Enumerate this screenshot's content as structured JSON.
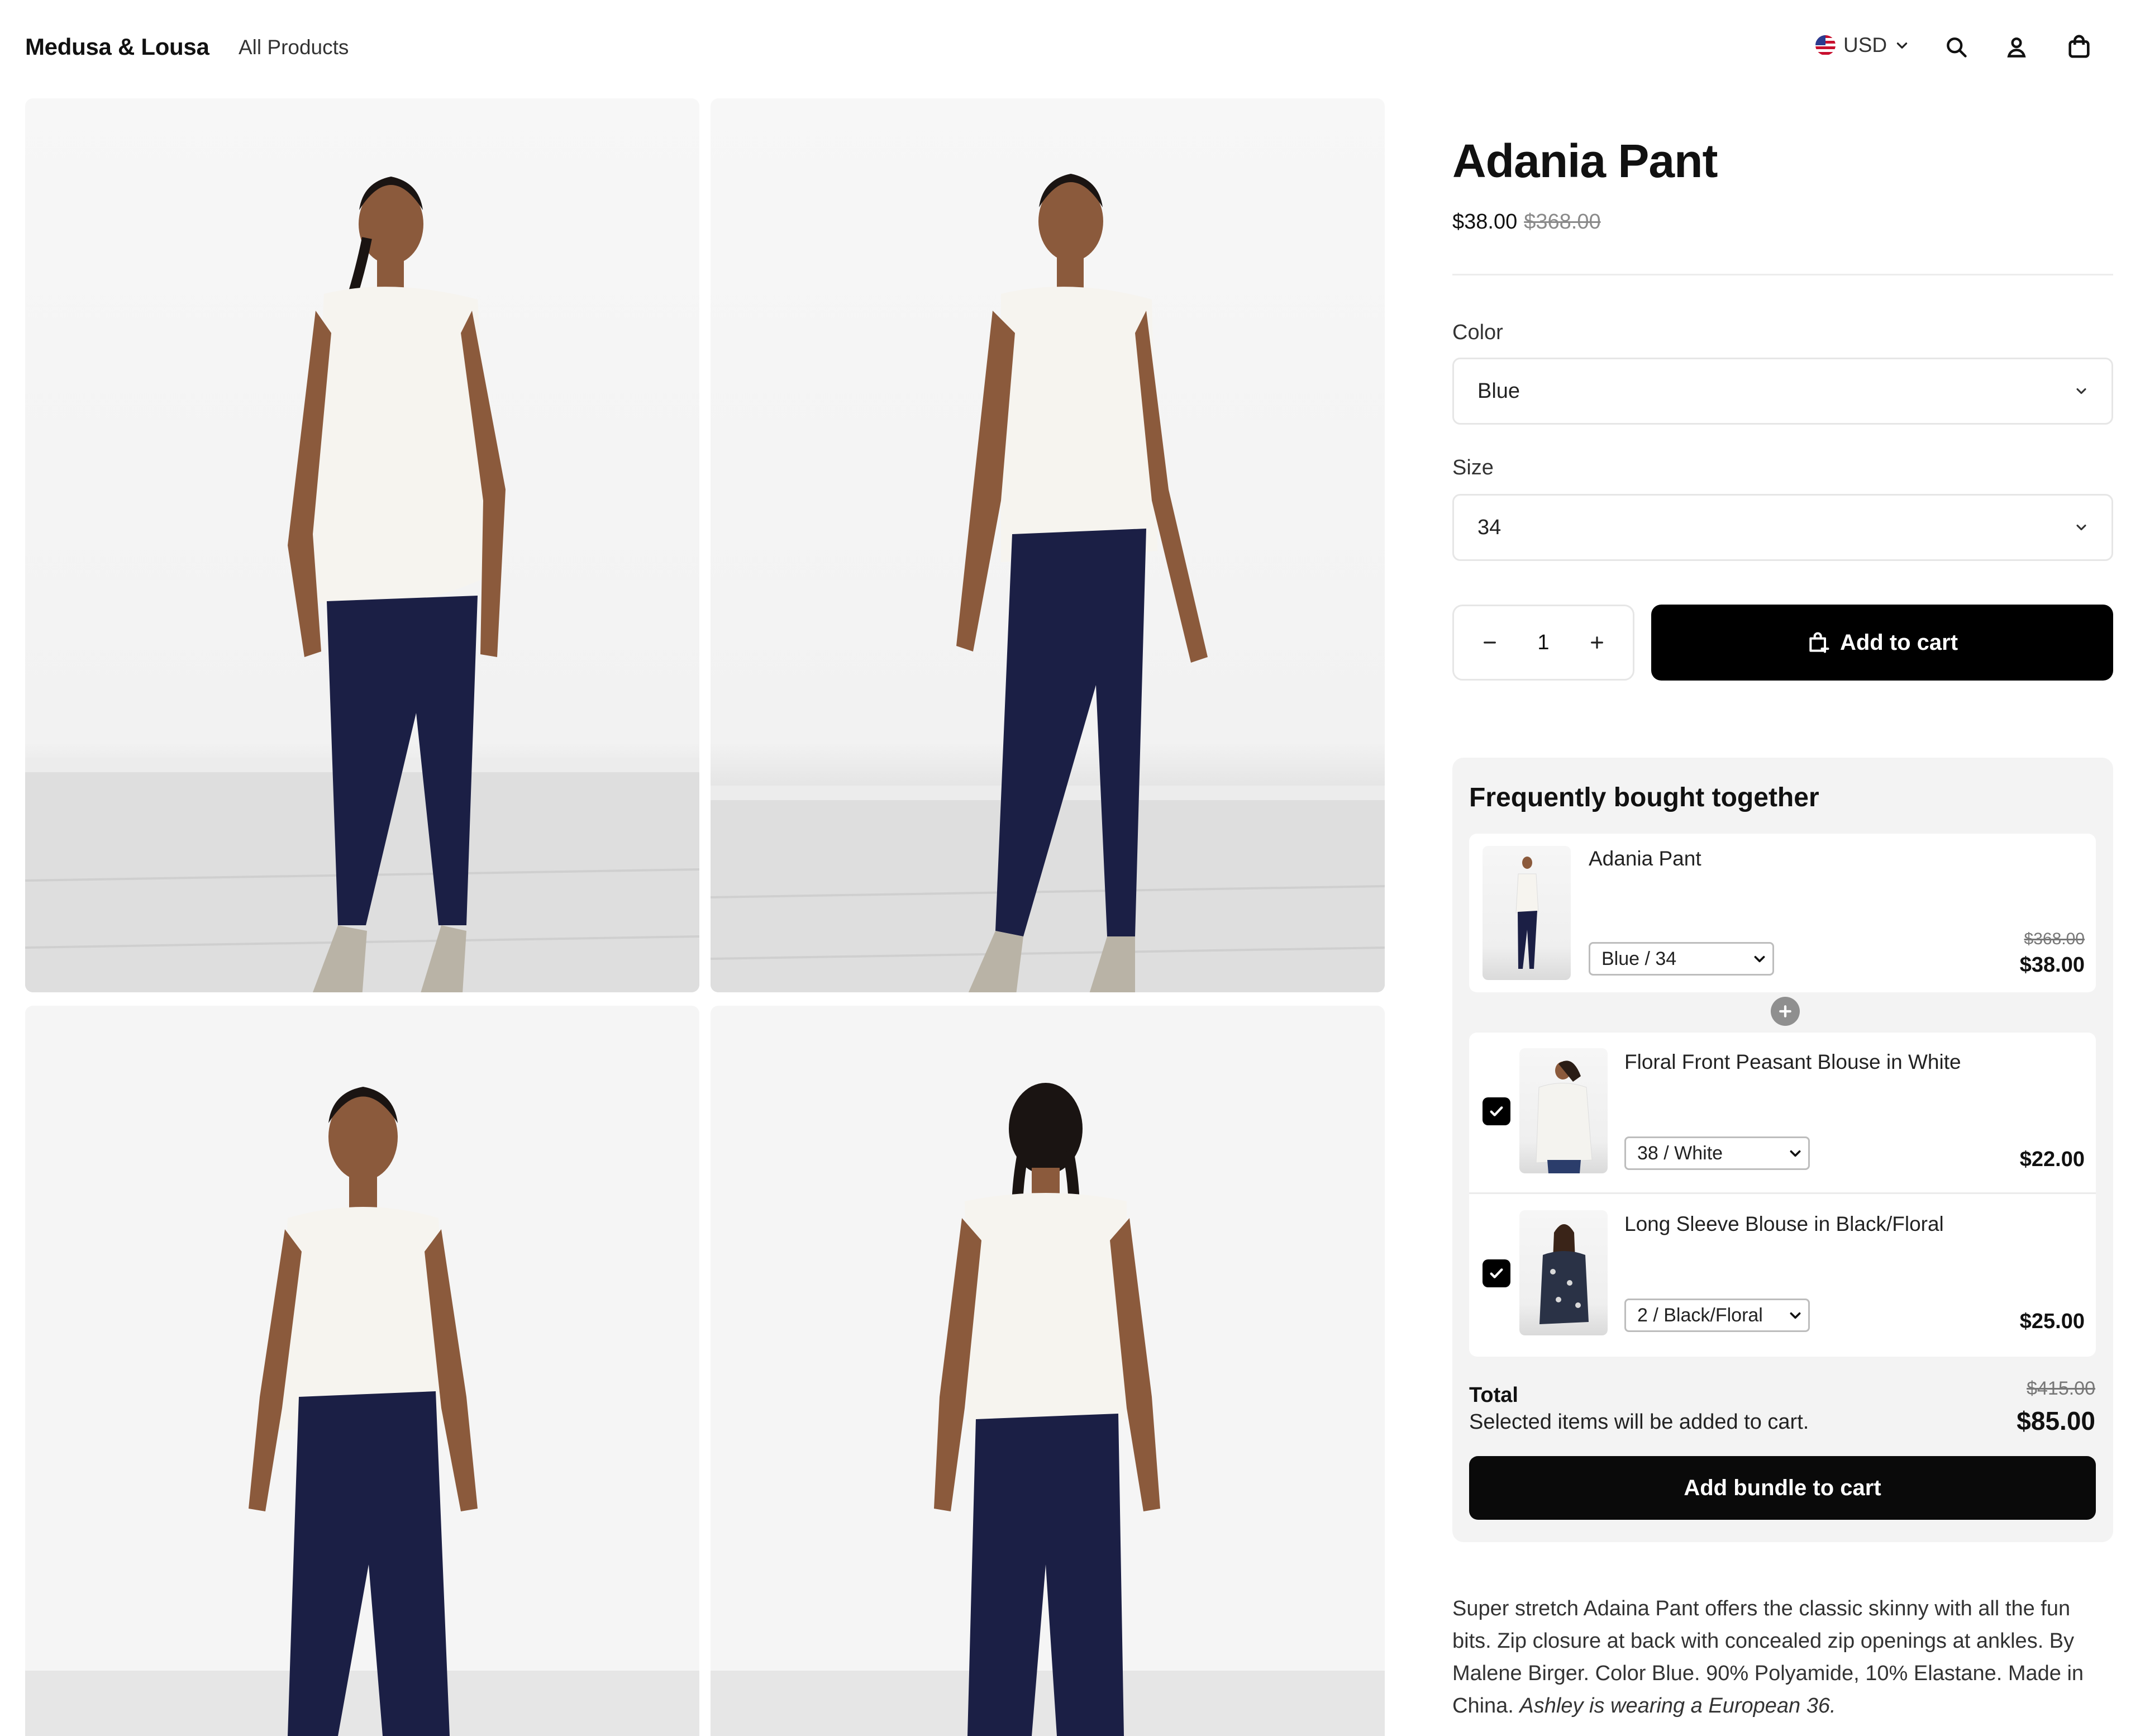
{
  "header": {
    "brand": "Medusa & Lousa",
    "nav_all_products": "All Products",
    "currency": "USD",
    "icons": [
      "search-icon",
      "user-icon",
      "shopping-bag-icon"
    ]
  },
  "product": {
    "title": "Adania Pant",
    "price": "$38.00",
    "original_price": "$368.00",
    "color_label": "Color",
    "color_value": "Blue",
    "size_label": "Size",
    "size_value": "34",
    "quantity": "1",
    "add_to_cart": "Add to cart"
  },
  "fbt": {
    "title": "Frequently bought together",
    "items": [
      {
        "name": "Adania Pant",
        "variant": "Blue / 34",
        "original_price": "$368.00",
        "price": "$38.00"
      },
      {
        "name": "Floral Front Peasant Blouse in White",
        "variant": "38 / White",
        "price": "$22.00",
        "checked": true
      },
      {
        "name": "Long Sleeve Blouse in Black/Floral",
        "variant": "2 / Black/Floral",
        "price": "$25.00",
        "checked": true
      }
    ],
    "total_label": "Total",
    "total_note": "Selected items will be added to cart.",
    "total_original": "$415.00",
    "total_price": "$85.00",
    "button": "Add bundle to cart"
  },
  "description": {
    "text": "Super stretch Adaina Pant offers the classic skinny with all the fun bits. Zip closure at back with concealed zip openings at ankles. By Malene Birger. Color Blue.  90% Polyamide, 10% Elastane. Made in China.",
    "note": "Ashley is wearing a European 36."
  },
  "colors": {
    "accent": "#000000",
    "panel_bg": "#f3f3f3",
    "pant": "#1b1f45"
  }
}
